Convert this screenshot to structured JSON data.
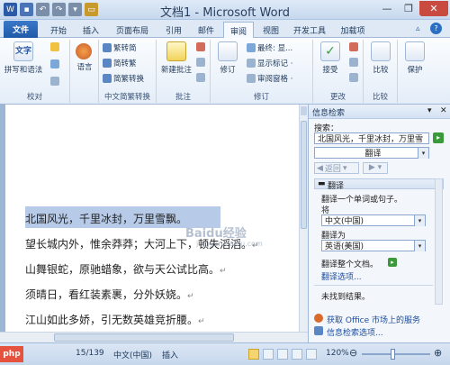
{
  "window": {
    "title": "文档1 - Microsoft Word"
  },
  "tabs": [
    {
      "label": "文件"
    },
    {
      "label": "开始"
    },
    {
      "label": "插入"
    },
    {
      "label": "页面布局"
    },
    {
      "label": "引用"
    },
    {
      "label": "邮件"
    },
    {
      "label": "审阅"
    },
    {
      "label": "视图"
    },
    {
      "label": "开发工具"
    },
    {
      "label": "加载项"
    }
  ],
  "ribbon": {
    "proofing": {
      "label": "校对",
      "spelling": "拼写和语法"
    },
    "language": {
      "label": "语言"
    },
    "chinese_conv": {
      "label": "中文简繁转换",
      "trad_to_simp": "繁转简",
      "simp_to_trad": "简转繁",
      "conv": "简繁转换"
    },
    "comments": {
      "label": "批注",
      "new_comment": "新建批注"
    },
    "tracking": {
      "label": "修订",
      "track": "修订",
      "final": "最终: 显...",
      "show_markup": "显示标记 ·",
      "review_pane": "审阅窗格 ·"
    },
    "changes": {
      "label": "更改",
      "accept": "接受"
    },
    "compare": {
      "label": "比较",
      "compare": "比较"
    },
    "protect": {
      "label": "保护"
    }
  },
  "document": {
    "lines": [
      "北国风光，千里冰封，万里雪飘。",
      "望长城内外，惟余莽莽；大河上下，顿失滔滔。",
      "山舞银蛇，原驰蜡象，欲与天公试比高。",
      "须晴日，看红装素裹，分外妖娆。",
      "江山如此多娇，引无数英雄竞折腰。"
    ],
    "para_mark": "↵"
  },
  "research_pane": {
    "title": "信息检索",
    "search_label": "搜索：",
    "search_value": "北国风光，千里冰封，万里雪",
    "service": "翻译",
    "back_label": "返回",
    "section": "翻译",
    "translate_hint": "翻译一个单词或句子。",
    "from_label": "将",
    "from_lang": "中文(中国)",
    "to_label": "翻译为",
    "to_lang": "英语(美国)",
    "translate_doc": "翻译整个文档。",
    "translate_options": "翻译选项...",
    "no_result": "未找到结果。",
    "office_market": "获取 Office 市场上的服务",
    "research_options": "信息检索选项..."
  },
  "status": {
    "words": "15/139",
    "language": "中文(中国)",
    "mode": "插入",
    "zoom": "120%"
  },
  "watermark": {
    "brand": "Baidu经验",
    "url": "jingyan.baidu.com",
    "php": "php"
  },
  "colors": {
    "accent": "#1f5aa8",
    "selection": "#b7cbe8",
    "ribbon_bg": "#e4edf8",
    "green_go": "#3a9a3a"
  }
}
